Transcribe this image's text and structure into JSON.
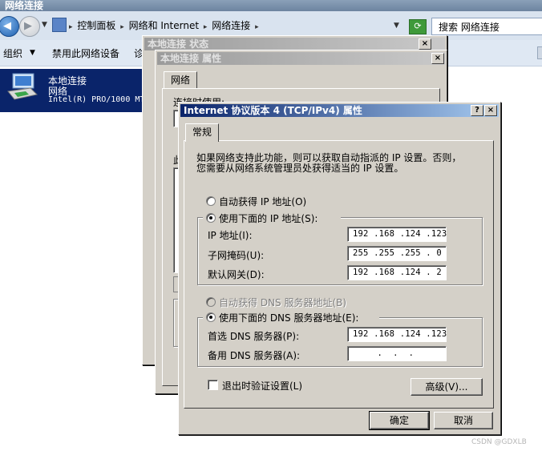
{
  "explorer": {
    "title": "网络连接",
    "breadcrumb": [
      "控制面板",
      "网络和 Internet",
      "网络连接"
    ],
    "search_placeholder": "搜索 网络连接",
    "toolbar": {
      "organize": "组织",
      "disable_device": "禁用此网络设备",
      "diagnose_truncated": "诊"
    },
    "connection": {
      "name": "本地连接",
      "network": "网络",
      "adapter": "Intel(R) PRO/1000 MT"
    }
  },
  "status_dialog": {
    "title": "本地连接 状态"
  },
  "props_dialog": {
    "title": "本地连接 属性",
    "tab": "网络",
    "connect_using_truncated": "连接时使用:",
    "section_truncated": "此"
  },
  "ipv4_dialog": {
    "title": "Internet 协议版本 4 (TCP/IPv4) 属性",
    "help_glyph": "?",
    "close_glyph": "×",
    "tab": "常规",
    "description": [
      "如果网络支持此功能，则可以获取自动指派的 IP 设置。否则，",
      "您需要从网络系统管理员处获得适当的 IP 设置。"
    ],
    "auto_ip_label": "自动获得 IP 地址(O)",
    "manual_ip_label": "使用下面的 IP 地址(S):",
    "ip_label": "IP 地址(I):",
    "ip_value": "192 .168 .124 .123",
    "subnet_label": "子网掩码(U):",
    "subnet_value": "255 .255 .255 . 0",
    "gateway_label": "默认网关(D):",
    "gateway_value": "192 .168 .124 . 2",
    "auto_dns_label": "自动获得 DNS 服务器地址(B)",
    "manual_dns_label": "使用下面的 DNS 服务器地址(E):",
    "preferred_dns_label": "首选 DNS 服务器(P):",
    "preferred_dns_value": "192 .168 .124 .123",
    "alternate_dns_label": "备用 DNS 服务器(A):",
    "alternate_dns_value": " .  .  .",
    "validate_label": "退出时验证设置(L)",
    "advanced_button": "高级(V)...",
    "ok_button": "确定",
    "cancel_button": "取消"
  },
  "watermark": "CSDN @GDXLB"
}
